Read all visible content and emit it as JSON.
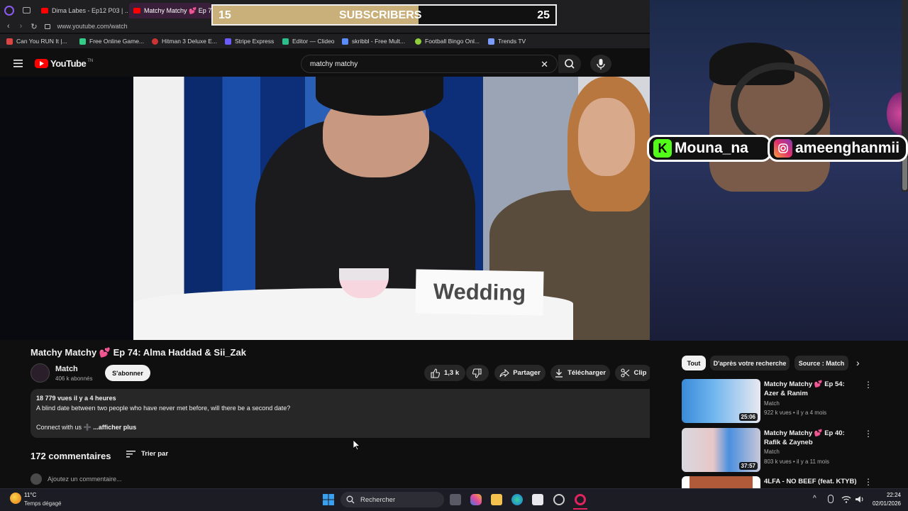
{
  "browser": {
    "tabs": [
      {
        "label": "Dima Labes - Ep12 P03 | ..."
      },
      {
        "label": "Matchy Matchy 💕 Ep 74"
      }
    ],
    "url": "www.youtube.com/watch",
    "bookmarks": [
      {
        "label": "Can You RUN It |..."
      },
      {
        "label": "Free Online Game..."
      },
      {
        "label": "Hitman 3 Deluxe E..."
      },
      {
        "label": "Stripe Express"
      },
      {
        "label": "Editor — Clideo"
      },
      {
        "label": "skribbl - Free Mult..."
      },
      {
        "label": "Football Bingo Onl..."
      },
      {
        "label": "Trends TV"
      }
    ]
  },
  "youtube": {
    "logo_text": "YouTube",
    "logo_suffix": "TN",
    "search_value": "matchy matchy"
  },
  "overlay": {
    "sub_current": "15",
    "sub_label": "SUBSCRIBERS",
    "sub_goal": "25",
    "sub_progress": 0.6,
    "tag_kick": "Mouna_na",
    "tag_instagram": "ameenghanmii",
    "placard": "Wedding"
  },
  "video": {
    "title": "Matchy Matchy 💕 Ep 74: Alma Haddad & Sii_Zak",
    "channel": "Match",
    "subscribers": "406 k abonnés",
    "subscribe_label": "S'abonner",
    "likes": "1,3 k",
    "share_label": "Partager",
    "download_label": "Télécharger",
    "clip_label": "Clip",
    "views_line": "18 779 vues  il y a 4 heures",
    "description": "A blind date between two people who have never met before, will there be a second date?",
    "connect": "Connect with us ➕",
    "more_label": "...afficher plus",
    "comment_count": "172 commentaires",
    "sort_label": "Trier par",
    "add_comment_placeholder": "Ajoutez un commentaire..."
  },
  "rail": {
    "chips": [
      {
        "label": "Tout"
      },
      {
        "label": "D'après votre recherche"
      },
      {
        "label": "Source : Match"
      }
    ],
    "videos": [
      {
        "title": "Matchy Matchy 💕 Ep 54: Azer & Ranim",
        "channel": "Match",
        "meta": "922 k vues • il y a 4 mois",
        "duration": "25:06"
      },
      {
        "title": "Matchy Matchy 💕 Ep 40: Rafik & Zayneb",
        "channel": "Match",
        "meta": "803 k vues • il y a 11 mois",
        "duration": "37:57"
      },
      {
        "title": "4LFA - NO BEEF (feat. KTYB)",
        "channel": "",
        "meta": "",
        "duration": ""
      }
    ]
  },
  "taskbar": {
    "temperature": "11°C",
    "weather": "Temps dégagé",
    "search_label": "Rechercher",
    "time": "22:24",
    "date": "02/01/2026"
  },
  "colors": {
    "yt_red": "#ff0000",
    "bg": "#0f0f0f",
    "chip_bg": "#272727",
    "sub_fill": "#c9b07a",
    "kick_green": "#53fc18"
  }
}
